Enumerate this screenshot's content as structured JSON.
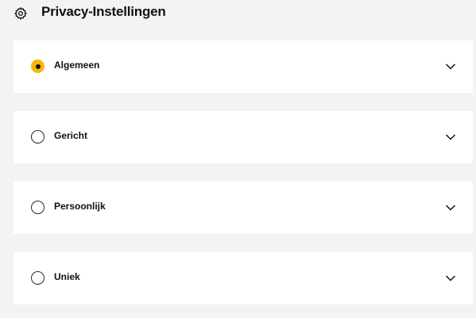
{
  "header": {
    "title": "Privacy-Instellingen",
    "icon": "gear-icon"
  },
  "options": [
    {
      "label": "Algemeen",
      "selected": true
    },
    {
      "label": "Gericht",
      "selected": false
    },
    {
      "label": "Persoonlijk",
      "selected": false
    },
    {
      "label": "Uniek",
      "selected": false
    }
  ],
  "colors": {
    "background": "#f3f3f3",
    "panel": "#ffffff",
    "accent": "#f6b800",
    "text": "#111111"
  }
}
